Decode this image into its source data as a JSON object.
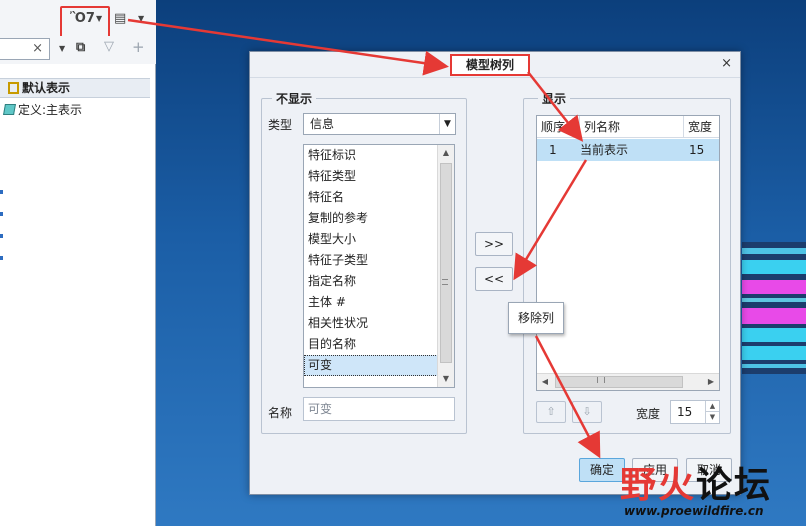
{
  "model_tree": {
    "search_clear": "×",
    "header_label": "默认表示",
    "tree_item_label": "定义:主表示",
    "plus_icon": "+"
  },
  "dialog": {
    "title": "模型树列",
    "close_glyph": "×",
    "not_shown": {
      "title": "不显示",
      "type_label": "类型",
      "type_value": "信息",
      "items": [
        "特征标识",
        "特征类型",
        "特征名",
        "复制的参考",
        "模型大小",
        "特征子类型",
        "指定名称",
        "主体 #",
        "相关性状况",
        "目的名称",
        "可变"
      ],
      "selected_index": 10,
      "name_label": "名称",
      "name_placeholder": "可变"
    },
    "move_buttons": {
      "add": ">>",
      "remove": "<<"
    },
    "shown": {
      "title": "显示",
      "headers": [
        "顺序",
        "列名称",
        "宽度"
      ],
      "rows": [
        {
          "order": "1",
          "name": "当前表示",
          "width": "15"
        }
      ],
      "width_label": "宽度",
      "width_value": "15"
    },
    "footer": {
      "ok": "确定",
      "apply": "应用",
      "cancel": "取消"
    }
  },
  "tooltip": {
    "text": "移除列"
  },
  "watermark": {
    "text_red": "野火",
    "text_black": "论坛",
    "url": "www.proewildfire.cn"
  },
  "colors": {
    "highlight": "#e53935",
    "selection": "#bfe0f6",
    "background": "#1b5ea6"
  }
}
